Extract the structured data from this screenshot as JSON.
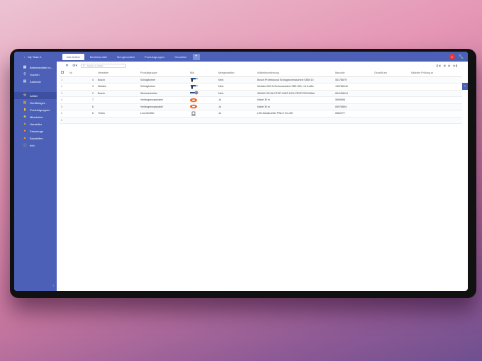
{
  "topbar": {
    "team": "My Team 1",
    "back_icon": "chevron-left-icon",
    "tabs": [
      {
        "label": "Alle Artikel",
        "active": true
      },
      {
        "label": "Betriebsmittel",
        "active": false
      },
      {
        "label": "Mengenartikel",
        "active": false
      },
      {
        "label": "Produktgruppen",
        "active": false
      },
      {
        "label": "Hersteller",
        "active": false
      }
    ],
    "add_tab_label": "+",
    "notification_count": "2",
    "accent": "#4b60b6",
    "badge_color": "#e53935"
  },
  "sidebar": {
    "items": [
      {
        "label": "Betriebsmittel im...",
        "icon": "dashboard-icon",
        "color": "#ffffff"
      },
      {
        "label": "Suchen",
        "icon": "search-icon",
        "color": "#ffffff"
      },
      {
        "label": "Kalender",
        "icon": "calendar-icon",
        "color": "#ffffff"
      },
      {
        "label": "Artikel",
        "icon": "tools-icon",
        "color": "#f5c542",
        "active": true
      },
      {
        "label": "Gerätelagen",
        "icon": "box-icon",
        "color": "#f5a623"
      },
      {
        "label": "Produktgruppen",
        "icon": "folder-icon",
        "color": "#f5c542"
      },
      {
        "label": "Mitarbeiter",
        "icon": "people-icon",
        "color": "#f5c542"
      },
      {
        "label": "Hersteller",
        "icon": "factory-icon",
        "color": "#f5a623"
      },
      {
        "label": "Fahrzeuge",
        "icon": "car-icon",
        "color": "#f5a623"
      },
      {
        "label": "Baustellen",
        "icon": "construction-icon",
        "color": "#f5a623"
      },
      {
        "label": "Info",
        "icon": "info-icon",
        "color": "#f5c542"
      }
    ],
    "collapse_icon": "chevron-left-icon"
  },
  "toolbar": {
    "search_placeholder": "Suchen in Artikel"
  },
  "table": {
    "columns": [
      "Nr",
      "Hersteller",
      "Produktgruppe",
      "Bild",
      "Mengenartikel",
      "Artikelbezeichnung",
      "Barcode",
      "Geprüft am",
      "Nächste Prüfung ar"
    ],
    "rows": [
      {
        "idx": "1",
        "nr": "4",
        "hersteller": "Bosch",
        "gruppe": "Schlagbohrer",
        "bild": "drill",
        "menge": "Nein",
        "bez": "Bosch Professional Schlagbohrmaschine GBM 10",
        "barcode": "55178679",
        "gepr": "",
        "next": ""
      },
      {
        "idx": "2",
        "nr": "3",
        "hersteller": "Metabo",
        "gruppe": "Schlagbohrer",
        "bild": "drill",
        "menge": "Nein",
        "bez": "Metabo 600 W Bohrmaschine SBE 650, mit Koffer",
        "barcode": "155786442",
        "gepr": "",
        "next": ""
      },
      {
        "idx": "3",
        "nr": "2",
        "hersteller": "Bosch",
        "gruppe": "Winkelschleifer",
        "bild": "grinder",
        "menge": "Nein",
        "bez": "WINKELSCHLEIFER GWS 1000 PROFESSIONAL",
        "barcode": "654158414",
        "gepr": "",
        "next": ""
      },
      {
        "idx": "4",
        "nr": "7",
        "hersteller": "",
        "gruppe": "Verlängerungskabel",
        "bild": "cable",
        "menge": "Ja",
        "bez": "Kabel 30 m",
        "barcode": "5895568",
        "gepr": "",
        "next": ""
      },
      {
        "idx": "5",
        "nr": "6",
        "hersteller": "",
        "gruppe": "Verlängerungskabel",
        "bild": "cable",
        "menge": "Ja",
        "bez": "Kabel 30 m",
        "barcode": "65978894",
        "gepr": "",
        "next": ""
      },
      {
        "idx": "6",
        "nr": "8",
        "hersteller": "Trotec",
        "gruppe": "Leuchtmittel",
        "bild": "lamp",
        "menge": "Ja",
        "bez": "LED-Baustrahler PWLS 10-150",
        "barcode": "8481977",
        "gepr": "",
        "next": ""
      },
      {
        "idx": "0",
        "nr": "",
        "hersteller": "",
        "gruppe": "",
        "bild": "",
        "menge": "",
        "bez": "",
        "barcode": "",
        "gepr": "",
        "next": ""
      }
    ]
  }
}
